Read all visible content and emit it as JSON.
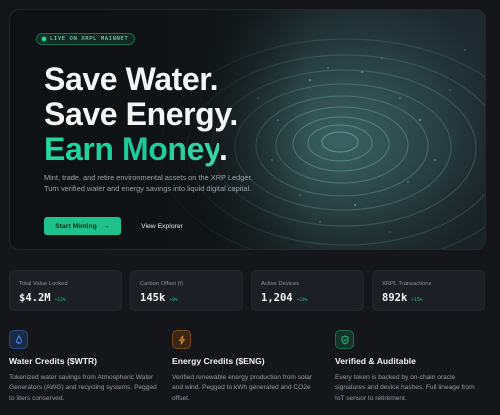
{
  "hero": {
    "live_badge": "LIVE ON XRPL MAINNET",
    "headline_line1": "Save Water.",
    "headline_line2": "Save Energy.",
    "headline_line3_accent": "Earn Money",
    "headline_line3_end": ".",
    "subtitle": "Mint, trade, and retire environmental assets on the XRP Ledger. Turn verified water and energy savings into liquid digital capital.",
    "primary_button": "Start Minting",
    "primary_button_icon": "arrow-right-icon",
    "secondary_button": "View Explorer"
  },
  "stats": [
    {
      "label": "Total Value Locked",
      "value": "$4.2M",
      "delta": "+12%"
    },
    {
      "label": "Carbon Offset (t)",
      "value": "145k",
      "delta": "+8%"
    },
    {
      "label": "Active Devices",
      "value": "1,204",
      "delta": "+24%"
    },
    {
      "label": "XRPL Transactions",
      "value": "892k",
      "delta": "+15%"
    }
  ],
  "features": [
    {
      "icon": "water-drop-icon",
      "title": "Water Credits ($WTR)",
      "description": "Tokenized water savings from Atmospheric Water Generators (AWG) and recycling systems. Pegged to liters conserved."
    },
    {
      "icon": "lightning-bolt-icon",
      "title": "Energy Credits ($ENG)",
      "description": "Verified renewable energy production from solar and wind. Pegged to kWh generated and CO2e offset."
    },
    {
      "icon": "shield-check-icon",
      "title": "Verified & Auditable",
      "description": "Every token is backed by on-chain oracle signatures and device hashes. Full lineage from IoT sensor to retirement."
    }
  ],
  "colors": {
    "background": "#141619",
    "accent_green": "#20c28c",
    "water_blue": "#3d7ee8",
    "energy_orange": "#e08a2e",
    "verified_green": "#2fc68f"
  }
}
